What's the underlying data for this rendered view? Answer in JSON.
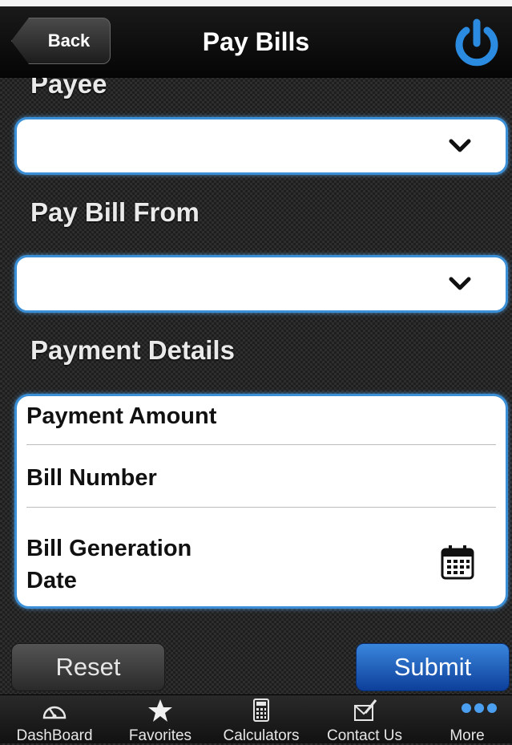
{
  "header": {
    "back_label": "Back",
    "title": "Pay Bills"
  },
  "form": {
    "payee_label": "Payee",
    "payee_value": "",
    "pay_from_label": "Pay Bill From",
    "pay_from_value": "",
    "details_label": "Payment Details",
    "details": {
      "amount_label": "Payment Amount",
      "bill_number_label": "Bill Number",
      "bill_date_label_line1": "Bill Generation",
      "bill_date_label_line2": "Date"
    }
  },
  "actions": {
    "reset_label": "Reset",
    "submit_label": "Submit"
  },
  "tabbar": {
    "items": [
      {
        "label": "DashBoard",
        "icon": "dashboard-icon"
      },
      {
        "label": "Favorites",
        "icon": "star-icon"
      },
      {
        "label": "Calculators",
        "icon": "calculator-icon"
      },
      {
        "label": "Contact Us",
        "icon": "contact-icon"
      },
      {
        "label": "More",
        "icon": "more-icon"
      }
    ]
  },
  "colors": {
    "accent": "#3a8fd6",
    "submit": "#1a5fc4",
    "power": "#2a8be0"
  }
}
